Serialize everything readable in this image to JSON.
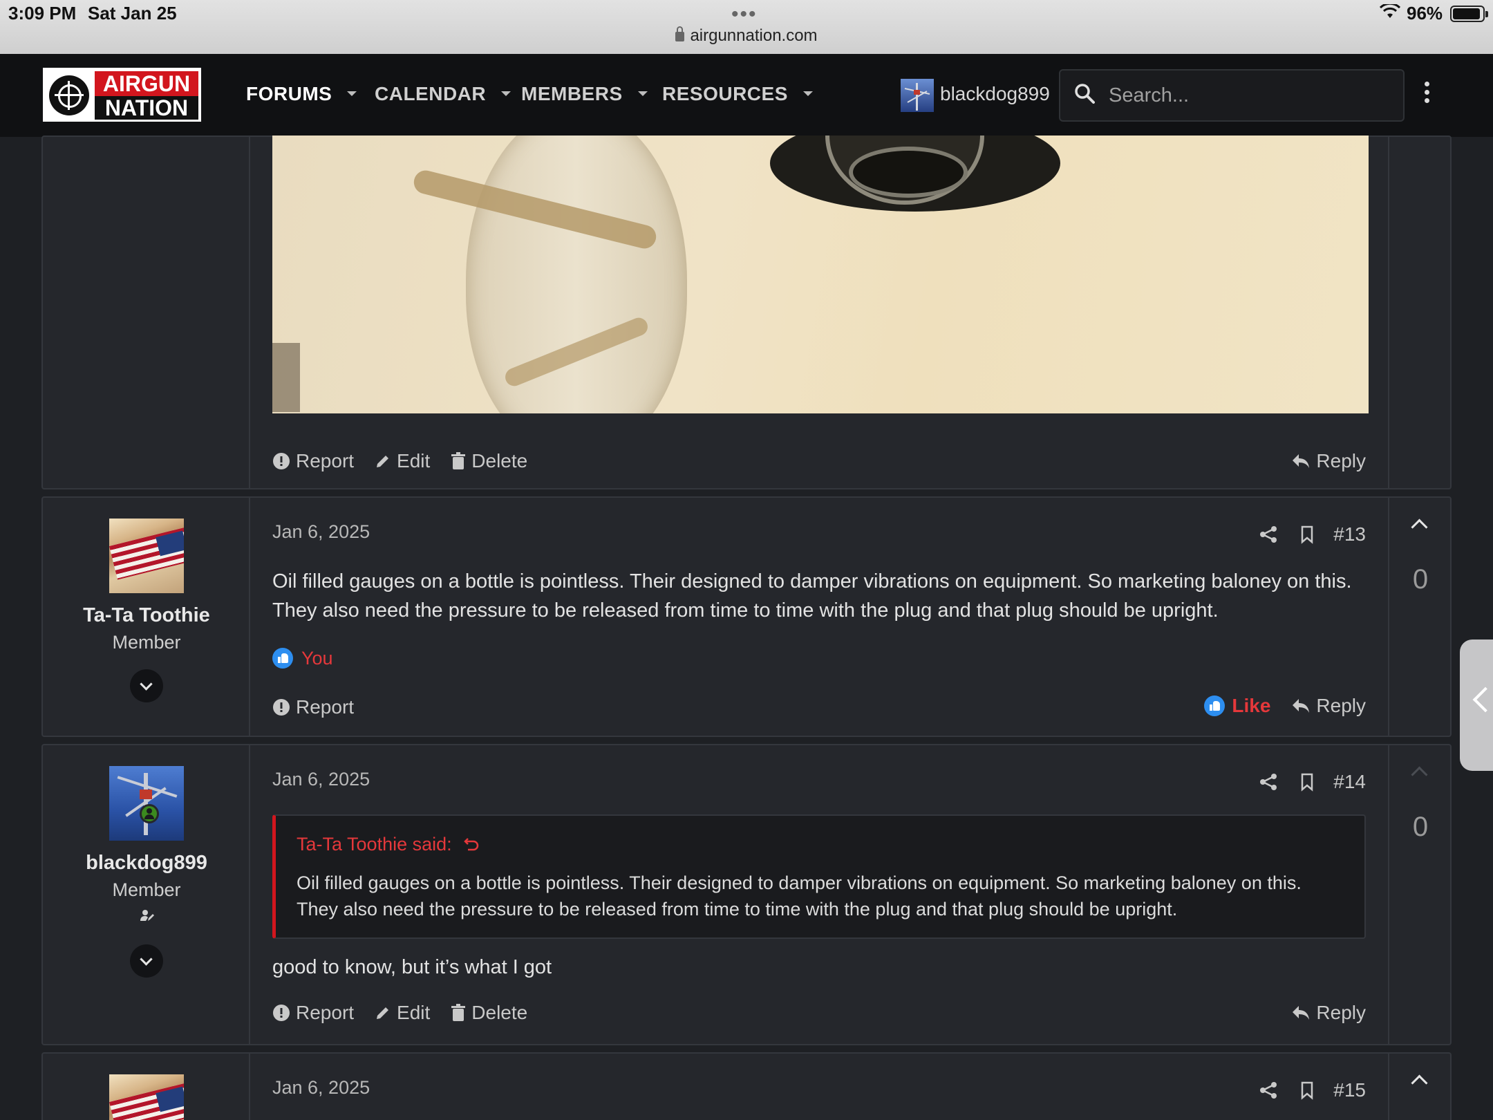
{
  "status_bar": {
    "time": "3:09 PM",
    "date": "Sat Jan 25",
    "dots": "•••",
    "url": "airgunnation.com",
    "battery": "96%"
  },
  "header": {
    "logo_line1": "AIRGUN",
    "logo_line2": "NATION",
    "nav": [
      "FORUMS",
      "CALENDAR",
      "MEMBERS",
      "RESOURCES"
    ],
    "username": "blackdog899",
    "search_placeholder": "Search..."
  },
  "post_prev": {
    "actions": {
      "report": "Report",
      "edit": "Edit",
      "delete": "Delete",
      "reply": "Reply"
    }
  },
  "post13": {
    "author": "Ta-Ta Toothie",
    "role": "Member",
    "date": "Jan 6, 2025",
    "number": "#13",
    "text": "Oil filled gauges on a bottle is pointless. Their designed to damper vibrations on equipment. So marketing baloney on this. They also need the pressure to be released from time to time with the plug and that plug should be upright.",
    "reaction_names": "You",
    "votes": "0",
    "actions": {
      "report": "Report",
      "like": "Like",
      "reply": "Reply"
    }
  },
  "post14": {
    "author": "blackdog899",
    "role": "Member",
    "date": "Jan 6, 2025",
    "number": "#14",
    "quote_author": "Ta-Ta Toothie said:",
    "quote_text": "Oil filled gauges on a bottle is pointless. Their designed to damper vibrations on equipment. So marketing baloney on this. They also need the pressure to be released from time to time with the plug and that plug should be upright.",
    "text": "good to know, but it’s what I got",
    "votes": "0",
    "actions": {
      "report": "Report",
      "edit": "Edit",
      "delete": "Delete",
      "reply": "Reply"
    }
  },
  "post15": {
    "date": "Jan 6, 2025",
    "number": "#15"
  }
}
